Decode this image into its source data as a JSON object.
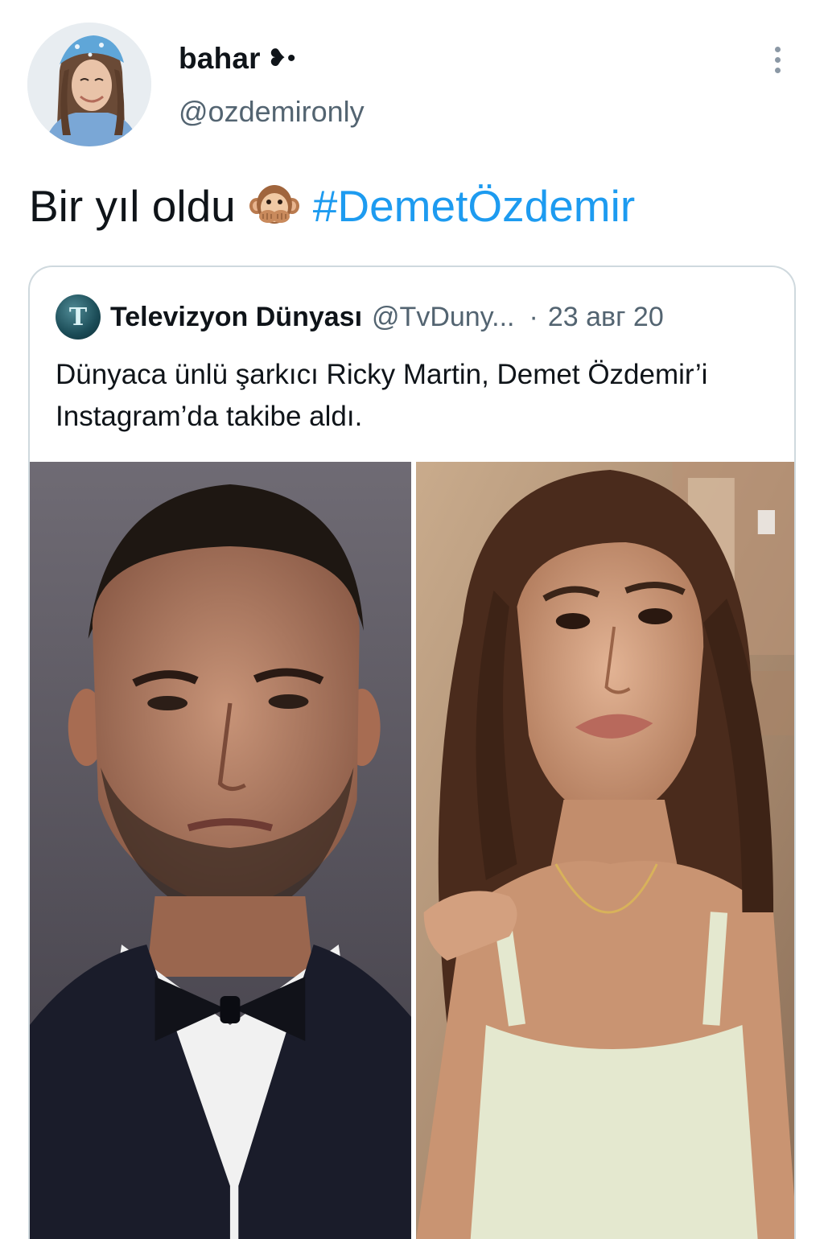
{
  "author": {
    "display_name": "bahar",
    "name_emoji": "❥•",
    "handle": "@ozdemironly"
  },
  "tweet": {
    "text": "Bir yıl oldu",
    "emoji": "speak-no-evil-monkey",
    "hashtag": "#DemetÖzdemir"
  },
  "quoted_tweet": {
    "avatar_letter": "T",
    "name": "Televizyon Dünyası",
    "handle": "@TvDuny...",
    "separator": "·",
    "date": "23 авг 20",
    "text": "Dünyaca ünlü şarkıcı Ricky Martin, Demet Özdemir’i Instagram’da takibe aldı.",
    "photos": [
      "man-in-tuxedo-photo",
      "woman-portrait-photo"
    ]
  },
  "colors": {
    "text_primary": "#0f1419",
    "text_secondary": "#536471",
    "link": "#1d9bf0",
    "border": "#cfd9de"
  }
}
